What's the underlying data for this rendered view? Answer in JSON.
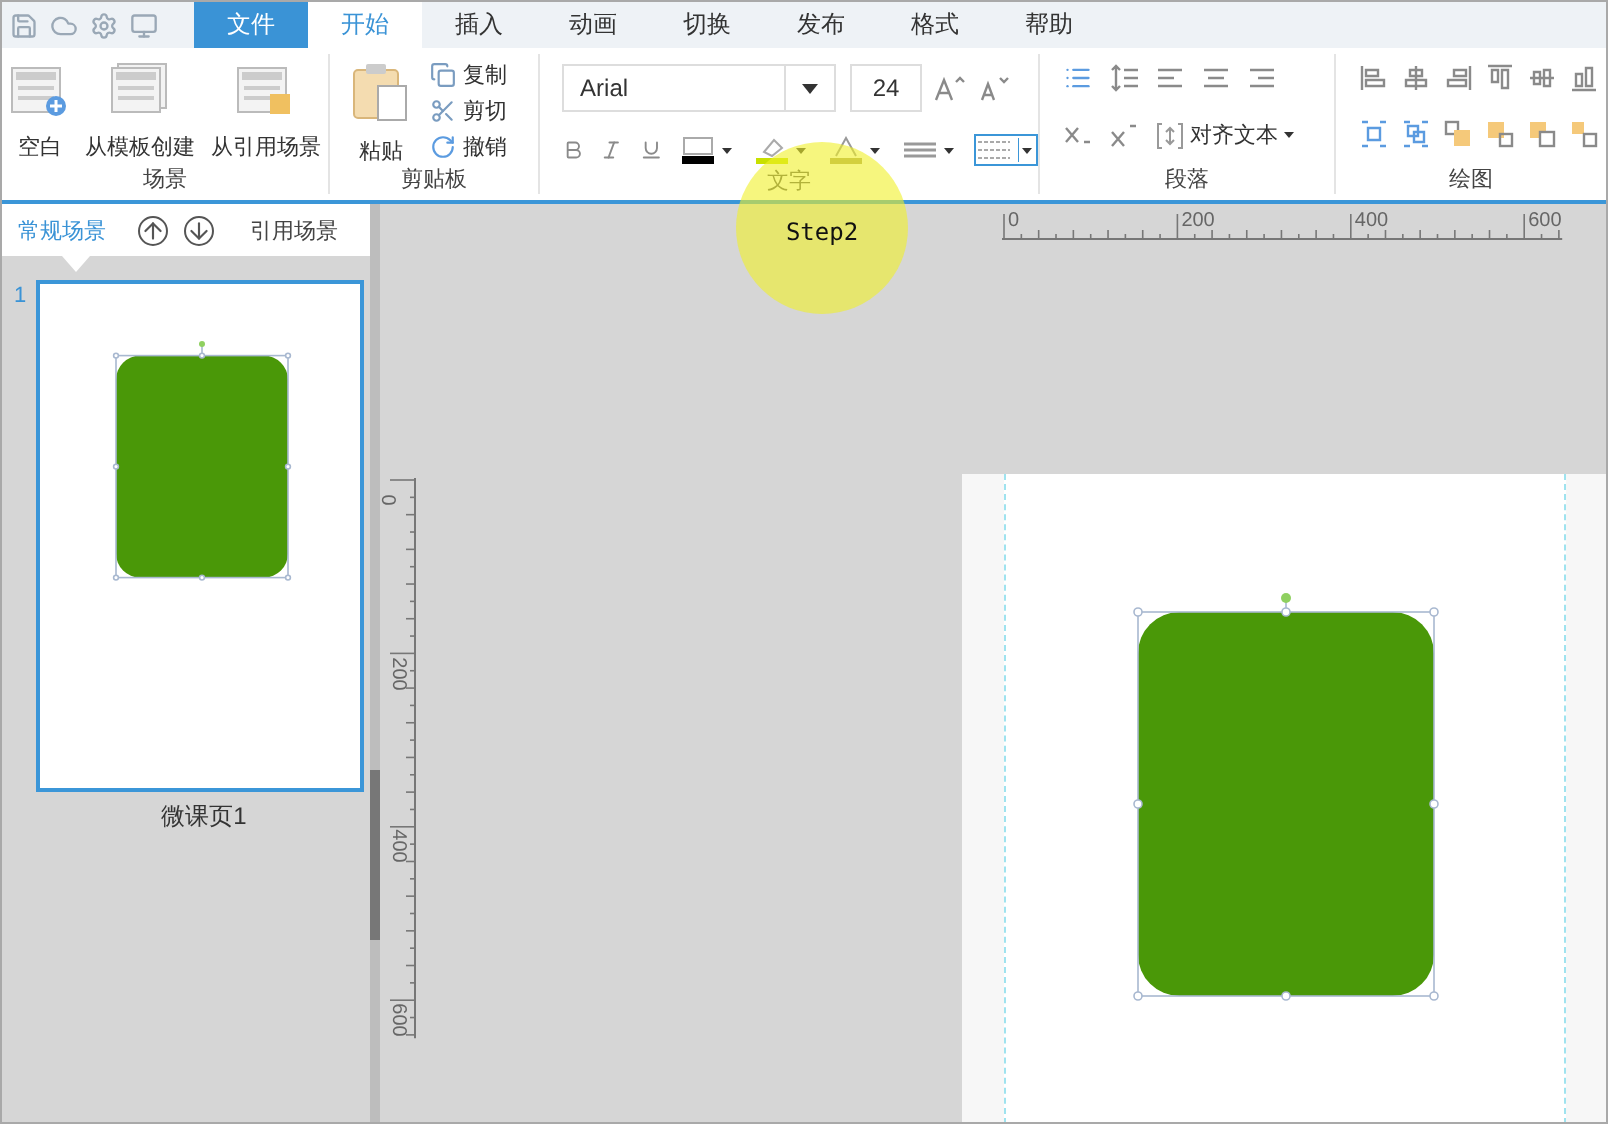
{
  "menu_tabs": [
    {
      "label": "文件",
      "kind": "file",
      "selected": false
    },
    {
      "label": "开始",
      "kind": "tab",
      "selected": true
    },
    {
      "label": "插入",
      "kind": "tab",
      "selected": false
    },
    {
      "label": "动画",
      "kind": "tab",
      "selected": false
    },
    {
      "label": "切换",
      "kind": "tab",
      "selected": false
    },
    {
      "label": "发布",
      "kind": "tab",
      "selected": false
    },
    {
      "label": "格式",
      "kind": "tab",
      "selected": false
    },
    {
      "label": "帮助",
      "kind": "tab",
      "selected": false
    }
  ],
  "ribbon": {
    "scene": {
      "title": "场景",
      "buttons": [
        "空白",
        "从模板创建",
        "从引用场景"
      ]
    },
    "clipboard": {
      "title": "剪贴板",
      "paste": "粘贴",
      "actions": [
        "复制",
        "剪切",
        "撤销"
      ]
    },
    "text": {
      "title": "文字",
      "font": "Arial",
      "size": "24",
      "border_style_selected": true
    },
    "paragraph": {
      "title": "段落",
      "align_text": "对齐文本"
    },
    "drawing": {
      "title": "绘图"
    }
  },
  "scene_panel": {
    "tabs": [
      {
        "label": "常规场景",
        "selected": true
      },
      {
        "label": "引用场景",
        "selected": false
      }
    ],
    "slides": [
      {
        "number": "1",
        "name": "微课页1",
        "selected": true
      }
    ]
  },
  "rulers": {
    "horizontal": [
      "0",
      "200",
      "400",
      "600"
    ],
    "vertical": [
      "0",
      "200",
      "400",
      "600"
    ]
  },
  "callout": {
    "label": "Step2"
  }
}
